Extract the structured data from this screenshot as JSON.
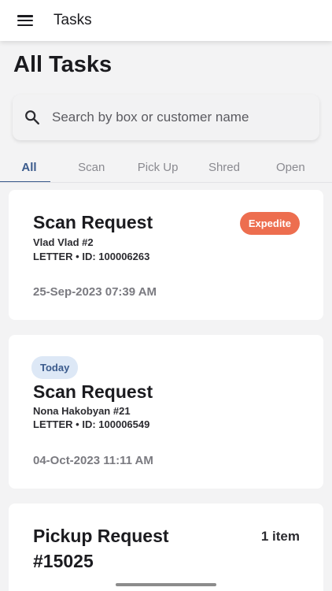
{
  "appbar": {
    "title": "Tasks"
  },
  "page": {
    "title": "All Tasks"
  },
  "search": {
    "placeholder": "Search by box or customer name"
  },
  "tabs": [
    {
      "label": "All",
      "active": true
    },
    {
      "label": "Scan"
    },
    {
      "label": "Pick Up"
    },
    {
      "label": "Shred"
    },
    {
      "label": "Open"
    }
  ],
  "cards": [
    {
      "title": "Scan Request",
      "badge": "Expedite",
      "customer": "Vlad Vlad #2",
      "meta": "LETTER • ID: 100006263",
      "date": "25-Sep-2023 07:39 AM"
    },
    {
      "title": "Scan Request",
      "badge": "Today",
      "customer": "Nona Hakobyan #21",
      "meta": "LETTER • ID: 100006549",
      "date": "04-Oct-2023 11:11 AM"
    },
    {
      "title_line1": "Pickup Request",
      "title_line2": "#15025",
      "count": "1 item"
    }
  ],
  "colors": {
    "accent": "#3a5a8c",
    "expedite": "#ed6e4f",
    "today_bg": "#dde8f6"
  }
}
